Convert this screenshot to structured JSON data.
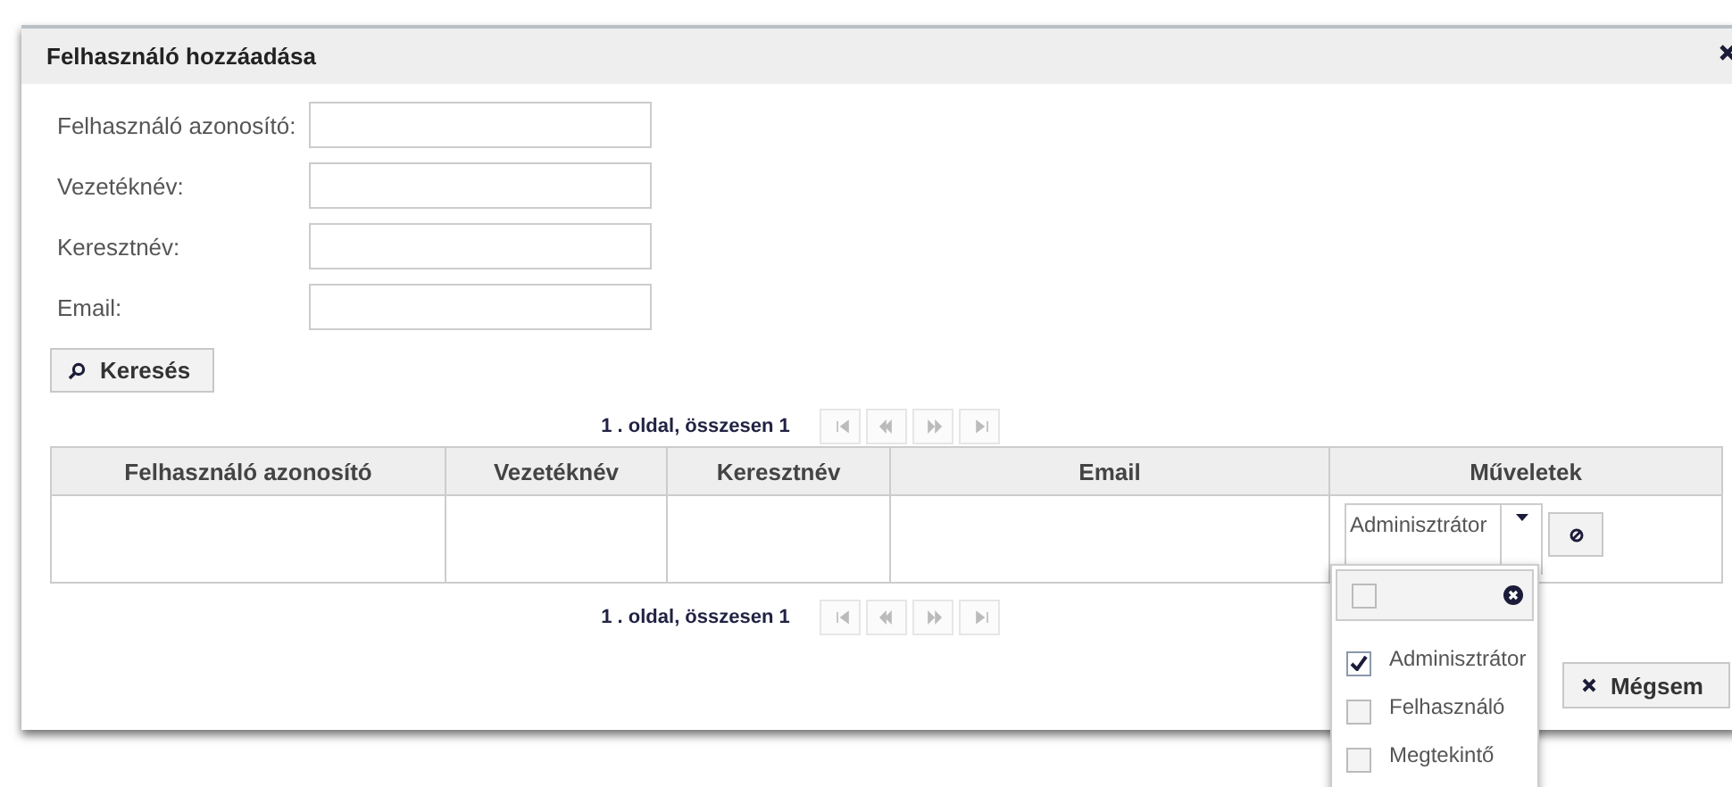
{
  "dialog": {
    "title": "Felhasználó hozzáadása"
  },
  "form": {
    "fields": [
      {
        "label": "Felhasználó azonosító:"
      },
      {
        "label": "Vezetéknév:"
      },
      {
        "label": "Keresztnév:"
      },
      {
        "label": "Email:"
      }
    ]
  },
  "search_button": {
    "label": "Keresés"
  },
  "pager_top": {
    "text": "1 . oldal, összesen 1",
    "buttons": [
      {
        "kind": "first",
        "disabled": true
      },
      {
        "kind": "prev",
        "disabled": true
      },
      {
        "kind": "next",
        "disabled": true
      },
      {
        "kind": "last",
        "disabled": true
      }
    ]
  },
  "table": {
    "columns": [
      "Felhasználó azonosító",
      "Vezetéknév",
      "Keresztnév",
      "Email",
      "Műveletek"
    ],
    "rows": [
      {
        "role_select": {
          "value": "Adminisztrátor",
          "expanded": true
        }
      }
    ]
  },
  "pager_bottom": {
    "text": "1 . oldal, összesen 1",
    "buttons": [
      {
        "kind": "first",
        "disabled": true
      },
      {
        "kind": "prev",
        "disabled": true
      },
      {
        "kind": "next",
        "disabled": true
      },
      {
        "kind": "last",
        "disabled": true
      }
    ]
  },
  "role_dropdown": {
    "select_all_checked": false,
    "options": [
      {
        "label": "Adminisztrátor",
        "checked": true
      },
      {
        "label": "Felhasználó",
        "checked": false
      },
      {
        "label": "Megtekintő",
        "checked": false
      }
    ]
  },
  "cancel_button": {
    "label": "Mégsem"
  }
}
